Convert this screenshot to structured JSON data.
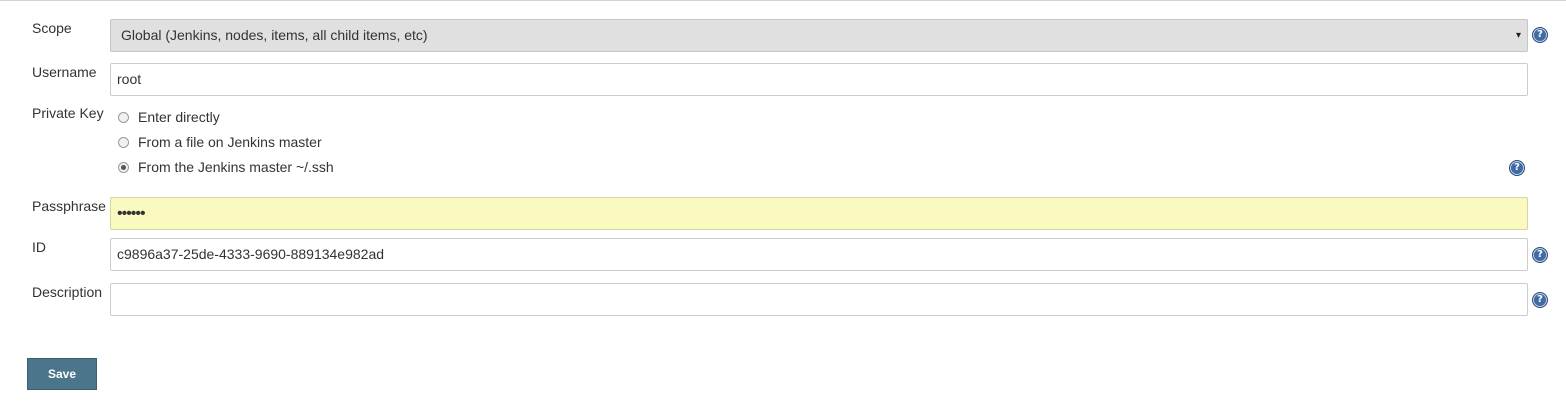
{
  "form": {
    "scope": {
      "label": "Scope",
      "selected": "Global (Jenkins, nodes, items, all child items, etc)",
      "arrow": "▾"
    },
    "username": {
      "label": "Username",
      "value": "root"
    },
    "private_key": {
      "label": "Private Key",
      "options": [
        {
          "label": "Enter directly",
          "checked": false
        },
        {
          "label": "From a file on Jenkins master",
          "checked": false
        },
        {
          "label": "From the Jenkins master ~/.ssh",
          "checked": true
        }
      ]
    },
    "passphrase": {
      "label": "Passphrase",
      "masked_value": "••••••"
    },
    "id": {
      "label": "ID",
      "value": "c9896a37-25de-4333-9690-889134e982ad"
    },
    "description": {
      "label": "Description",
      "value": ""
    },
    "help_glyph": "?",
    "save_label": "Save"
  },
  "colors": {
    "save_button_bg": "#4b758b",
    "passphrase_bg": "#fafac0",
    "select_bg": "#e0e0e0",
    "help_icon_bg": "#3f6aa4"
  },
  "icons": {
    "help": "help-icon",
    "select_arrow": "chevron-down-icon"
  }
}
